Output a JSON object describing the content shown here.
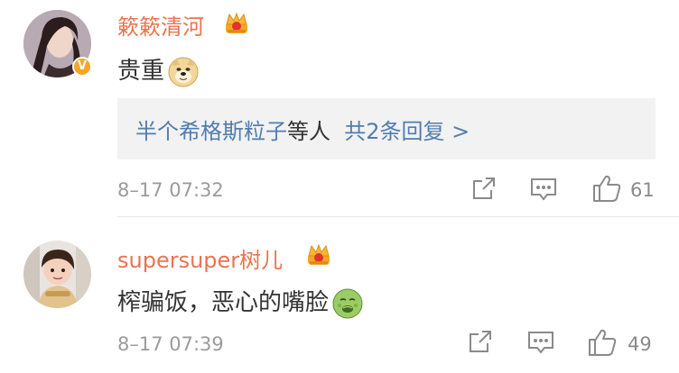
{
  "comments": [
    {
      "username": "簌簌清河",
      "text": "贵重",
      "emoji_icon": "doge-emoji",
      "reply_preview": {
        "name": "半个希格斯粒子",
        "middle": "等人",
        "more": "共2条回复 >"
      },
      "time": "8–17 07:32",
      "likes": "61",
      "verified_badge": "V"
    },
    {
      "username": "supersuper树儿",
      "text": "榨骗饭，恶心的嘴脸",
      "emoji_icon": "nauseated-face-emoji",
      "time": "8–17 07:39",
      "likes": "49"
    }
  ],
  "colors": {
    "username": "#eb7350",
    "link": "#507daf",
    "meta": "#9b9b9b",
    "reply_bg": "#f2f2f2",
    "badge": "#f5a623"
  },
  "icons": [
    "crown-icon",
    "share-icon",
    "comment-icon",
    "like-icon"
  ]
}
